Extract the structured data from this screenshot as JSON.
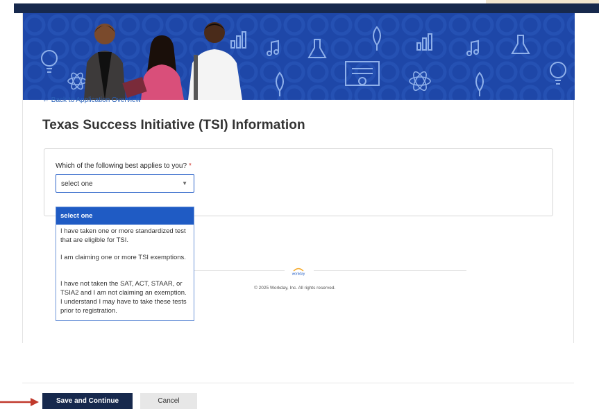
{
  "nav": {
    "back_link": "← Back to Application Overview"
  },
  "page": {
    "title": "Texas Success Initiative (TSI) Information"
  },
  "question": {
    "label": "Which of the following best applies to you?",
    "required_marker": "*",
    "selected_value": "select one",
    "options": [
      "select one",
      "I have taken one or more standardized test that are eligible for TSI.",
      "I am claiming one or more TSI exemptions.",
      "I have not taken the SAT, ACT, STAAR, or TSIA2 and I am not claiming an exemption. I understand I may have to take these tests prior to registration."
    ]
  },
  "footer": {
    "logo_text": "workday",
    "copyright": "© 2025 Workday, Inc. All rights reserved."
  },
  "actions": {
    "save_continue": "Save and Continue",
    "cancel": "Cancel"
  },
  "colors": {
    "brand_navy": "#17294d",
    "banner_blue": "#1e47a8",
    "selection_blue": "#1f5bc4",
    "required_red": "#d0342c",
    "arrow_red": "#c0392b"
  },
  "icons": {
    "chevron": "chevron-down-icon",
    "arrow": "red-arrow-icon"
  }
}
